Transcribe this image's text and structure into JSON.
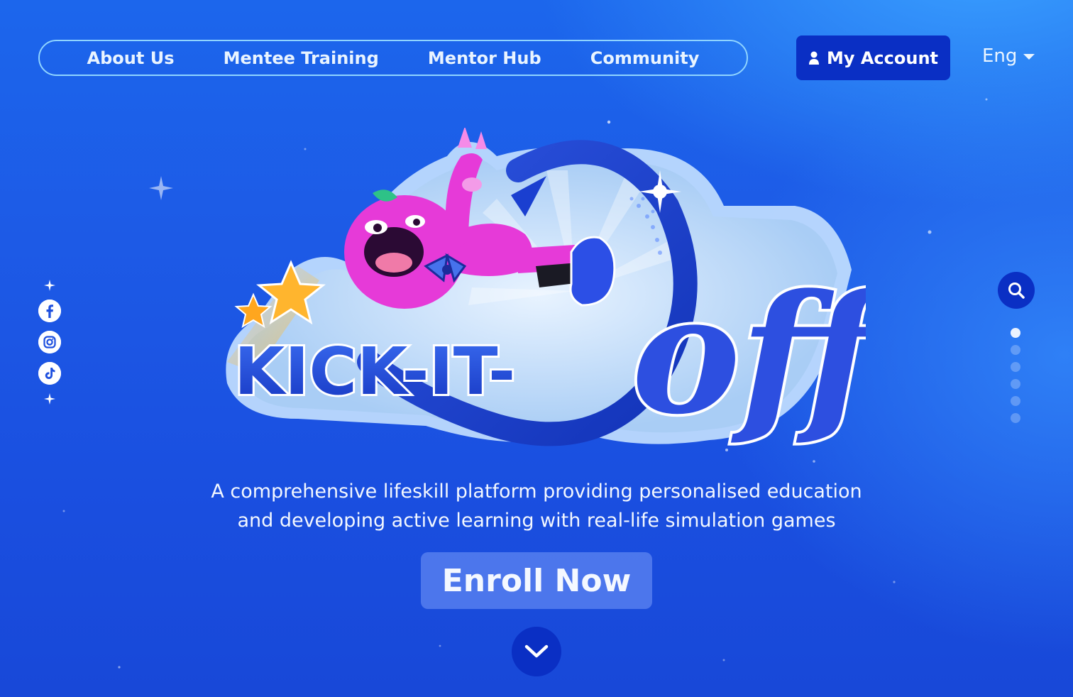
{
  "nav": {
    "items": [
      {
        "label": "About Us"
      },
      {
        "label": "Mentee Training"
      },
      {
        "label": "Mentor Hub"
      },
      {
        "label": "Community"
      }
    ],
    "account_label": "My Account",
    "account_icon": "user-icon",
    "language": "Eng",
    "language_icon": "caret-down-icon"
  },
  "social": {
    "icons": [
      "facebook-icon",
      "instagram-icon",
      "tiktok-icon"
    ]
  },
  "side_controls": {
    "search_icon": "search-icon",
    "pagination_count": 6,
    "active_page": 1
  },
  "hero": {
    "logo_text_main": "KICK-IT-",
    "logo_text_script": "off",
    "tagline_line1": "A comprehensive lifeskill platform providing personalised education",
    "tagline_line2": "and developing active learning with real-life simulation games",
    "cta_label": "Enroll Now",
    "scroll_icon": "chevron-down-icon"
  },
  "colors": {
    "background": "#1c5ee8",
    "primary_button": "#0a2fc4",
    "nav_border": "#8fd4ff",
    "mascot_pink": "#e63ad8",
    "star_yellow": "#ffb52e"
  }
}
